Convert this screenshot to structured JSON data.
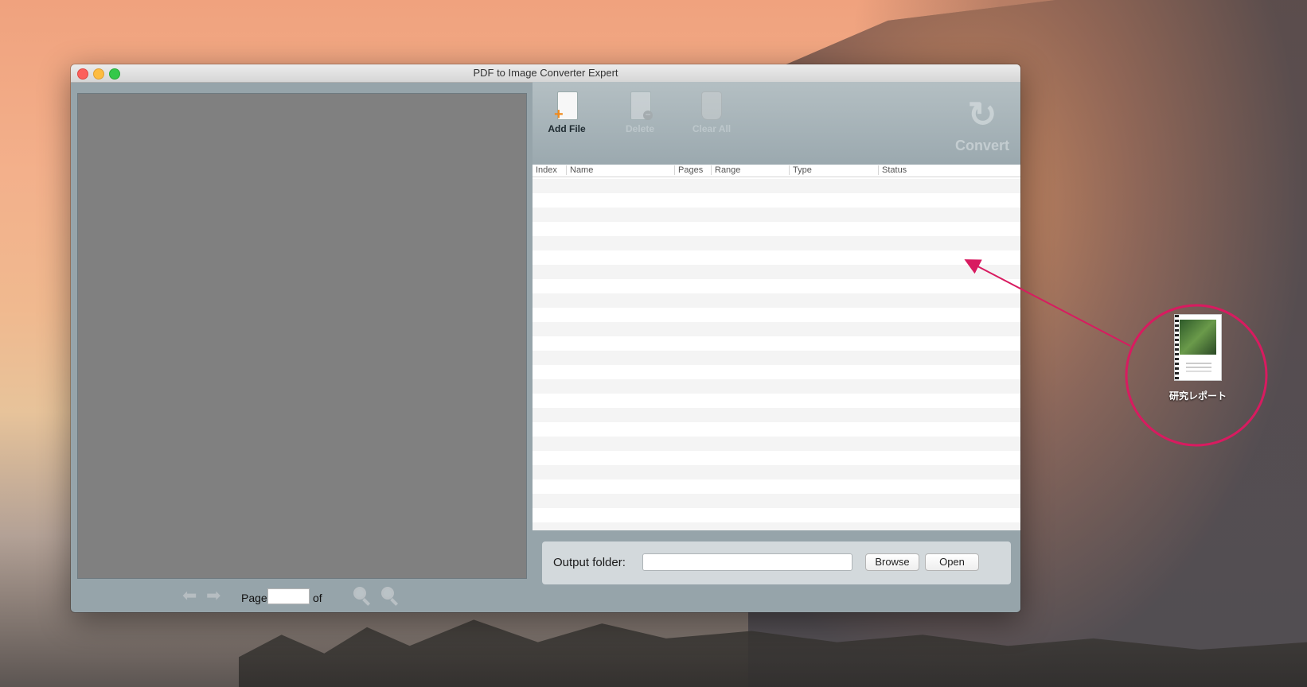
{
  "window": {
    "title": "PDF to Image Converter Expert"
  },
  "toolbar": {
    "add_file": "Add File",
    "delete": "Delete",
    "clear_all": "Clear All",
    "convert": "Convert"
  },
  "table": {
    "columns": [
      "Index",
      "Name",
      "Pages",
      "Range",
      "Type",
      "Status"
    ]
  },
  "pager": {
    "page_label": "Page",
    "page_value": "",
    "of_label": "of"
  },
  "output": {
    "label": "Output folder:",
    "value": "",
    "browse": "Browse",
    "open": "Open"
  },
  "desktop": {
    "file_name": "研究レポート"
  },
  "colors": {
    "accent_arrow": "#d81b60",
    "window_body": "#96a4aa",
    "preview_bg": "#808080"
  },
  "icons": [
    "arrow-left-icon",
    "arrow-right-icon",
    "zoom-out-icon",
    "zoom-in-icon",
    "add-file-icon",
    "delete-icon",
    "clear-all-icon",
    "convert-icon"
  ]
}
